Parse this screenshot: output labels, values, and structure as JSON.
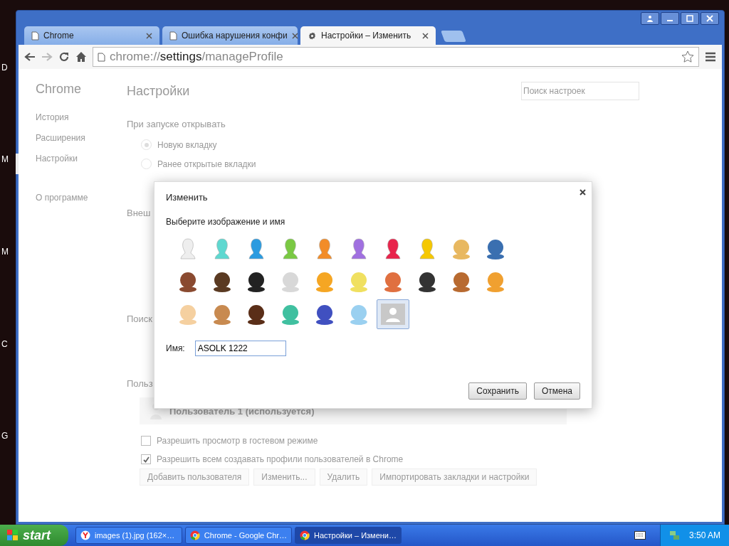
{
  "desktop_labels": [
    "D",
    "M",
    "M",
    "C",
    "G"
  ],
  "tabs": [
    {
      "title": "Chrome",
      "selected": false
    },
    {
      "title": "Ошибка нарушения конфи",
      "selected": false
    },
    {
      "title": "Настройки – Изменить",
      "selected": true
    }
  ],
  "address": {
    "scheme": "chrome://",
    "host": "settings",
    "path": "/manageProfile"
  },
  "sidebar": {
    "title": "Chrome",
    "items": [
      {
        "label": "История",
        "selected": false
      },
      {
        "label": "Расширения",
        "selected": false
      },
      {
        "label": "Настройки",
        "selected": true
      },
      {
        "label": "О программе",
        "selected": false
      }
    ]
  },
  "settings": {
    "title": "Настройки",
    "search": {
      "placeholder": "Поиск настроек"
    },
    "startup": {
      "heading": "При запуске открывать",
      "options": [
        {
          "label": "Новую вкладку",
          "selected": true
        },
        {
          "label": "Ранее открытые вкладки",
          "selected": false
        }
      ]
    },
    "cut_headings": [
      "Внеш",
      "Поиск",
      "Польз"
    ],
    "user": "Пользователь 1 (используется)",
    "checks": [
      {
        "label": "Разрешить просмотр в гостевом режиме",
        "checked": false
      },
      {
        "label": "Разрешить всем создавать профили пользователей в Chrome",
        "checked": true
      }
    ],
    "buttons": [
      "Добавить пользователя",
      "Изменить...",
      "Удалить",
      "Импортировать закладки и настройки"
    ]
  },
  "dialog": {
    "title": "Изменить",
    "subtitle": "Выберите изображение и имя",
    "avatars": [
      {
        "kind": "silhouette",
        "color": "#eeeeee",
        "selected": false
      },
      {
        "kind": "silhouette",
        "color": "#5fd8d0",
        "selected": false
      },
      {
        "kind": "silhouette",
        "color": "#2b9be0",
        "selected": false
      },
      {
        "kind": "silhouette",
        "color": "#7ac943",
        "selected": false
      },
      {
        "kind": "silhouette",
        "color": "#f28c28",
        "selected": false
      },
      {
        "kind": "silhouette",
        "color": "#a070e0",
        "selected": false
      },
      {
        "kind": "silhouette",
        "color": "#e8244c",
        "selected": false
      },
      {
        "kind": "silhouette",
        "color": "#f5c800",
        "selected": false
      },
      {
        "kind": "picture",
        "color": "#e8b860",
        "selected": false
      },
      {
        "kind": "picture",
        "color": "#3a6fb0",
        "selected": false
      },
      {
        "kind": "picture",
        "color": "#8a4a30",
        "selected": false
      },
      {
        "kind": "picture",
        "color": "#5a3a22",
        "selected": false
      },
      {
        "kind": "picture",
        "color": "#222222",
        "selected": false
      },
      {
        "kind": "picture",
        "color": "#d8d8d8",
        "selected": false
      },
      {
        "kind": "picture",
        "color": "#f5a623",
        "selected": false
      },
      {
        "kind": "picture",
        "color": "#f0e060",
        "selected": false
      },
      {
        "kind": "picture",
        "color": "#e07040",
        "selected": false
      },
      {
        "kind": "picture",
        "color": "#333333",
        "selected": false
      },
      {
        "kind": "picture",
        "color": "#b86a30",
        "selected": false
      },
      {
        "kind": "picture",
        "color": "#f0a030",
        "selected": false
      },
      {
        "kind": "picture",
        "color": "#f5d0a0",
        "selected": false
      },
      {
        "kind": "picture",
        "color": "#c88a50",
        "selected": false
      },
      {
        "kind": "picture",
        "color": "#5a2e18",
        "selected": false
      },
      {
        "kind": "picture",
        "color": "#40c0a0",
        "selected": false
      },
      {
        "kind": "picture",
        "color": "#4050c0",
        "selected": false
      },
      {
        "kind": "picture",
        "color": "#9ad0f0",
        "selected": false
      },
      {
        "kind": "generic",
        "color": "#c8c8c8",
        "selected": true
      }
    ],
    "name_label": "Имя:",
    "name_value": "ASOLK 1222",
    "buttons": [
      "Сохранить",
      "Отмена"
    ]
  },
  "taskbar": {
    "start": "start",
    "items": [
      {
        "label": "images (1).jpg (162×…",
        "selected": false
      },
      {
        "label": "Chrome - Google Chr…",
        "selected": false
      },
      {
        "label": "Настройки – Измени…",
        "selected": true
      }
    ],
    "clock": "3:50 AM"
  }
}
